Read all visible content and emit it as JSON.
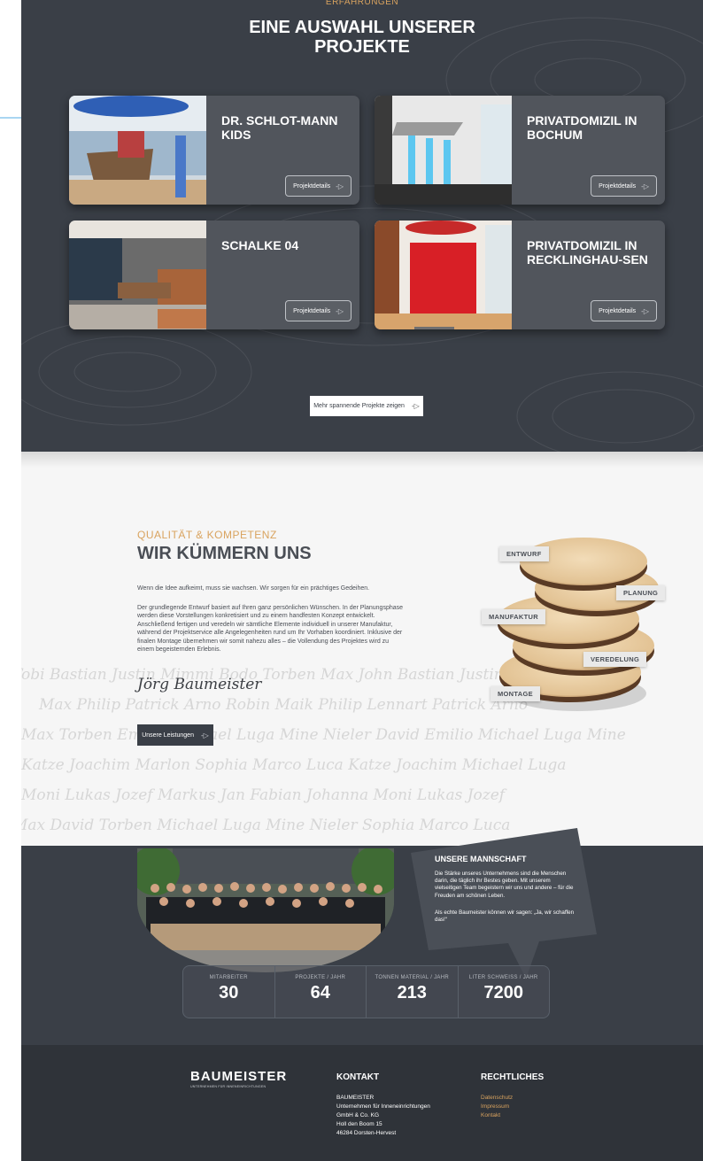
{
  "projects_section": {
    "eyebrow": "ERFAHRUNGEN",
    "title_line1": "EINE AUSWAHL UNSERER",
    "title_line2": "PROJEKTE",
    "cards": [
      {
        "title": "DR. SCHLOT-MANN KIDS",
        "button": "Projektdetails"
      },
      {
        "title": "PRIVATDOMIZIL IN BOCHUM",
        "button": "Projektdetails"
      },
      {
        "title": "SCHALKE 04",
        "button": "Projektdetails"
      },
      {
        "title": "PRIVATDOMIZIL IN RECKLINGHAU-SEN",
        "button": "Projektdetails"
      }
    ],
    "more_button": "Mehr spannende Projekte zeigen"
  },
  "about": {
    "eyebrow": "QUALITÄT & KOMPETENZ",
    "title": "WIR KÜMMERN UNS",
    "para1": "Wenn die Idee aufkeimt, muss sie wachsen. Wir sorgen für ein prächtiges Gedeihen.",
    "para2": "Der grundlegende Entwurf basiert auf Ihren ganz persönlichen Wünschen. In der Planungsphase werden diese Vorstellungen konkretisiert und zu einem handfesten Konzept entwickelt. Anschließend fertigen und veredeln wir sämtliche Elemente individuell in unserer Manufaktur, während der Projektservice alle Angelegenheiten rund um Ihr Vorhaben koordiniert. Inklusive der finalen Montage übernehmen wir somit nahezu alles – die Vollendung des Projektes wird zu einem begeisternden Erlebnis.",
    "signature": "Jörg Baumeister",
    "button": "Unsere Leistungen",
    "tags": {
      "entwurf": "ENTWURF",
      "planung": "PLANUNG",
      "manufaktur": "MANUFAKTUR",
      "veredelung": "VEREDELUNG",
      "montage": "MONTAGE"
    },
    "names": [
      "Tobi Bastian Justin Mimmi Bodo Torben Max John Bastian Justin Mimmi",
      "Max Philip Patrick Arno Robin Maik Philip Lennart Patrick Arno",
      "Max Torben Emilio Michael Luga Mine Nieler David Emilio Michael Luga Mine",
      "Katze Joachim Marlon Sophia Marco Luca Katze Joachim Michael Luga",
      "Moni Lukas Jozef Markus Jan Fabian Johanna Moni Lukas Jozef",
      "Max David Torben Michael Luga Mine Nieler Sophia Marco Luca"
    ]
  },
  "team": {
    "title": "UNSERE MANNSCHAFT",
    "text1": "Die Stärke unseres Unternehmens sind die Menschen darin, die täglich ihr Bestes geben. Mit unserem vielseitigen Team begeistern wir uns und andere – für die Freuden am schönen Leben.",
    "text2": "Als echte Baumeister können wir sagen: „Ja, wir schaffen das!“",
    "stats": [
      {
        "label": "MITARBEITER",
        "value": "30"
      },
      {
        "label": "PROJEKTE / JAHR",
        "value": "64"
      },
      {
        "label": "TONNEN MATERIAL / JAHR",
        "value": "213"
      },
      {
        "label": "LITER SCHWEISS / JAHR",
        "value": "7200"
      }
    ]
  },
  "footer": {
    "logo_word": "BAUMEISTER",
    "logo_sub": "UNTERNEHMEN FÜR INNENEINRICHTUNGEN",
    "contact_title": "KONTAKT",
    "contact_lines": [
      "BAUMEISTER",
      "Unternehmen für Inneneinrichtungen",
      "GmbH & Co. KG",
      "Holl den Boom 15",
      "46284 Dorsten-Hervest"
    ],
    "legal_title": "RECHTLICHES",
    "legal_links": [
      "Datenschutz",
      "Impressum",
      "Kontakt"
    ]
  }
}
